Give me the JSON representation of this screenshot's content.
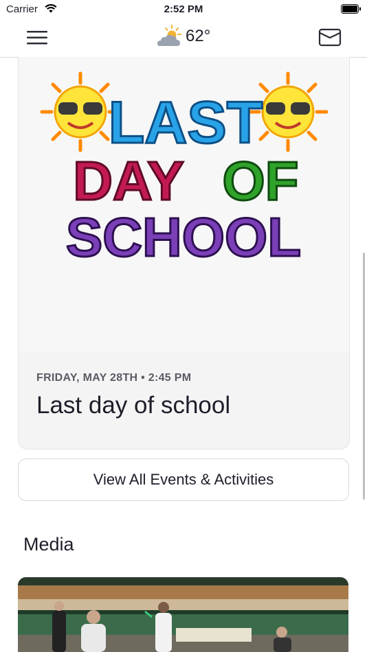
{
  "status_bar": {
    "carrier": "Carrier",
    "time": "2:52 PM"
  },
  "nav": {
    "menu_icon": "hamburger-menu-icon",
    "weather_icon": "partly-cloudy-icon",
    "temperature": "62°",
    "mail_icon": "envelope-icon"
  },
  "event": {
    "image_text": {
      "line1": "LAST",
      "line2_a": "DAY",
      "line2_b": "OF",
      "line3": "SCHOOL"
    },
    "date": "FRIDAY, MAY 28TH • 2:45 PM",
    "title": "Last day of school"
  },
  "view_all_label": "View All Events & Activities",
  "media": {
    "section_title": "Media",
    "thumbnail": "gym-sports-photo"
  },
  "colors": {
    "accent_text": "#1e1e2a",
    "card_bg": "#f4f4f5",
    "muted": "#5a5a63"
  }
}
